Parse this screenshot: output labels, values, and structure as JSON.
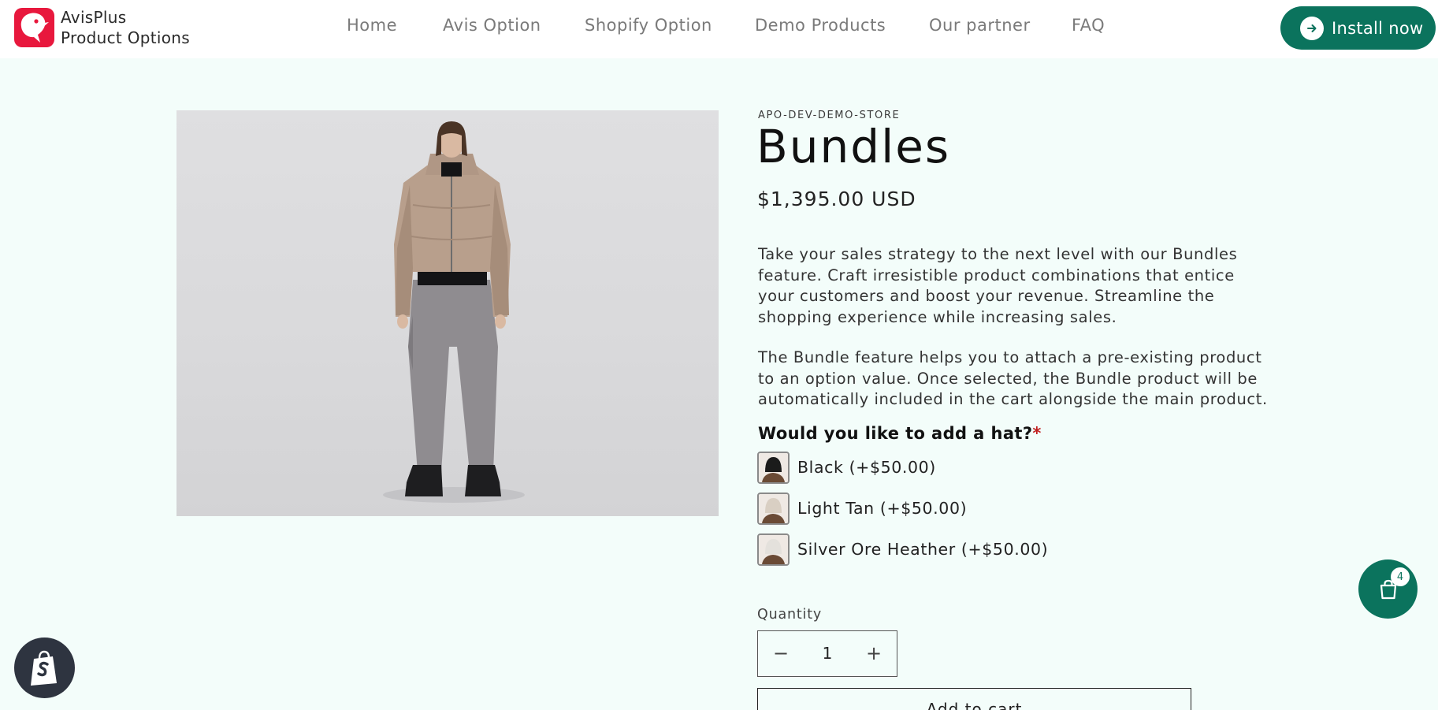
{
  "brand": {
    "line1": "AvisPlus",
    "line2": "Product Options"
  },
  "nav": {
    "items": [
      {
        "label": "Home"
      },
      {
        "label": "Avis Option"
      },
      {
        "label": "Shopify Option"
      },
      {
        "label": "Demo Products"
      },
      {
        "label": "Our partner"
      },
      {
        "label": "FAQ"
      }
    ],
    "install_label": "Install now"
  },
  "product": {
    "vendor": "APO-DEV-DEMO-STORE",
    "title": "Bundles",
    "price": "$1,395.00 USD",
    "description_1": "Take your sales strategy to the next level with our Bundles feature. Craft irresistible product combinations that entice your customers and boost your revenue. Streamline the shopping experience while increasing sales.",
    "description_2": "The Bundle feature helps you to attach a pre-existing product to an option value. Once selected, the Bundle product will be automatically included in the cart alongside the main product.",
    "option": {
      "label": "Would you like to add a hat?",
      "required_mark": "*",
      "values": [
        {
          "label": "Black (+$50.00)",
          "swatch": "#1b1b1b"
        },
        {
          "label": "Light Tan (+$50.00)",
          "swatch": "#d9cfc3"
        },
        {
          "label": "Silver Ore Heather (+$50.00)",
          "swatch": "#e4e1dc"
        }
      ]
    },
    "quantity": {
      "label": "Quantity",
      "value": "1",
      "minus": "−",
      "plus": "+"
    },
    "add_to_cart": "Add to cart"
  },
  "cart": {
    "count": "4"
  },
  "colors": {
    "accent": "#0b735d",
    "background": "#f3fdfa",
    "brand_red": "#e8183d"
  }
}
